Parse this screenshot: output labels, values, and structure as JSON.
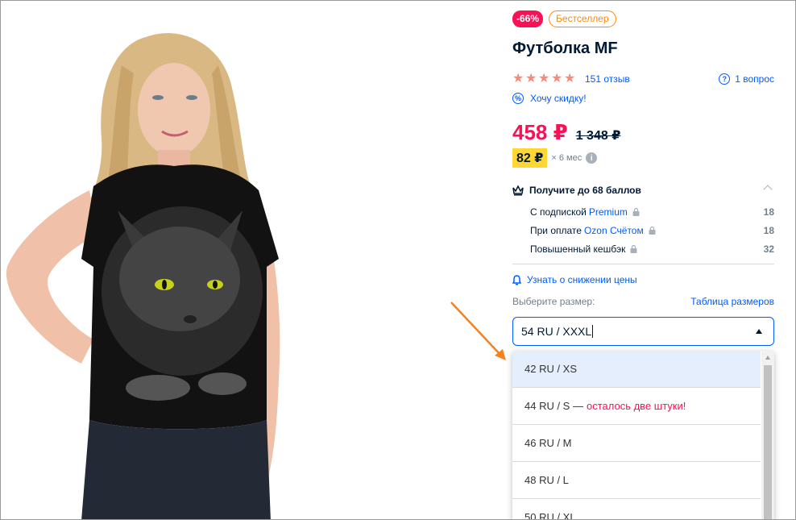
{
  "badges": {
    "discount": "-66%",
    "bestseller": "Бестселлер"
  },
  "product": {
    "title": "Футболка MF"
  },
  "rating": {
    "stars": 5,
    "reviews_label": "151 отзыв"
  },
  "questions": {
    "label": "1 вопрос"
  },
  "discount_request": {
    "label": "Хочу скидку!"
  },
  "price": {
    "current": "458 ₽",
    "old": "1 348 ₽"
  },
  "installment": {
    "amount": "82 ₽",
    "term": "× 6 мес"
  },
  "points": {
    "heading": "Получите до 68 баллов",
    "rows": [
      {
        "prefix": "С подпиской",
        "link": "Premium",
        "value": "18"
      },
      {
        "prefix": "При оплате",
        "link": "Ozon Счётом",
        "value": "18"
      },
      {
        "prefix": "Повышенный кешбэк",
        "link": "",
        "value": "32"
      }
    ]
  },
  "notify": {
    "label": "Узнать о снижении цены"
  },
  "size": {
    "label": "Выберите размер:",
    "table_link": "Таблица размеров",
    "selected": "54 RU / XXXL",
    "options": [
      {
        "label": "42 RU / XS",
        "note": ""
      },
      {
        "label": "44 RU / S —",
        "note": "осталось две штуки!"
      },
      {
        "label": "46 RU / M",
        "note": ""
      },
      {
        "label": "48 RU / L",
        "note": ""
      },
      {
        "label": "50 RU / XL",
        "note": ""
      }
    ]
  },
  "colors": {
    "accent": "#005bff",
    "sale": "#f91155",
    "star": "#f98a77",
    "installment": "#ffd633",
    "annotation_arrow": "#f58220"
  }
}
